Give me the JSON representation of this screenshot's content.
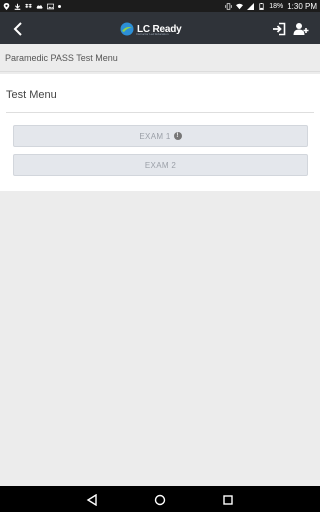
{
  "status_bar": {
    "battery": "18%",
    "time": "1:30 PM"
  },
  "app_bar": {
    "logo_text": "LC Ready",
    "logo_sub": "Instructor Led Education"
  },
  "breadcrumb": "Paramedic PASS Test Menu",
  "menu": {
    "title": "Test Menu",
    "items": [
      {
        "label": "EXAM 1"
      },
      {
        "label": "EXAM 2"
      }
    ]
  },
  "colors": {
    "app_bar": "#2f3339",
    "status_bar": "#1c1c1c",
    "page_bg": "#ececec",
    "button_bg": "#e4e7ec",
    "button_text": "#9ba0a8"
  }
}
